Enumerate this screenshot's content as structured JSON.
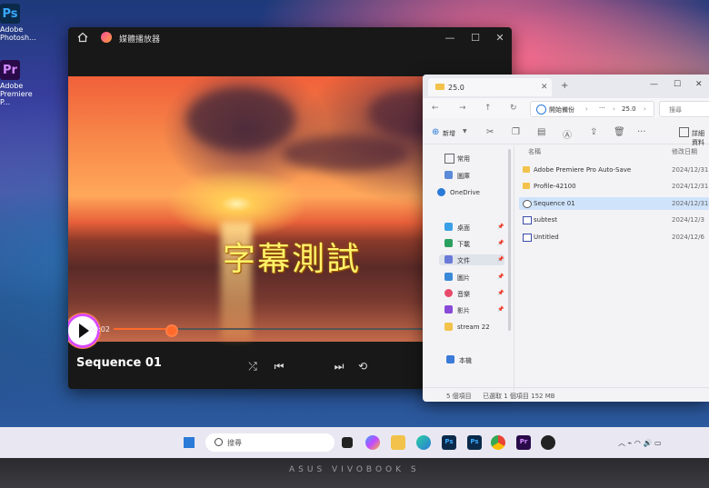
{
  "desktop": {
    "icons": [
      {
        "glyph": "Ps",
        "label": "Adobe Photosh..."
      },
      {
        "glyph": "Pr",
        "label": "Adobe Premiere P..."
      }
    ]
  },
  "player": {
    "title": "媒體播放器",
    "subtitle_text": "字幕測試",
    "current_time": "00:00:02",
    "progress_fraction": 0.15,
    "media_title": "Sequence 01",
    "accent_color": "#ff6a2a",
    "icons": [
      "home-icon",
      "shuffle-icon",
      "previous-icon",
      "play-icon",
      "next-icon",
      "repeat-off-icon"
    ]
  },
  "explorer": {
    "tab_title": "25.0",
    "address": {
      "start": "開始備份",
      "more": "···",
      "folder": "25.0"
    },
    "search_placeholder": "搜尋",
    "toolbar": {
      "new_label": "新增",
      "details_label": "詳細資料"
    },
    "nav": {
      "home": "常用",
      "gallery": "圖庫",
      "onedrive": "OneDrive",
      "desktop": "桌面",
      "downloads": "下載",
      "documents": "文件",
      "pictures": "圖片",
      "music": "音樂",
      "videos": "影片",
      "stream": "stream 22",
      "thispc": "本機"
    },
    "columns": {
      "name": "名稱",
      "date": "修改日期"
    },
    "files": [
      {
        "name": "Adobe Premiere Pro Auto-Save",
        "date": "2024/12/31",
        "type": "folder"
      },
      {
        "name": "Profile-42100",
        "date": "2024/12/31",
        "type": "folder"
      },
      {
        "name": "Sequence 01",
        "date": "2024/12/31",
        "type": "sequence"
      },
      {
        "name": "subtest",
        "date": "2024/12/3",
        "type": "document"
      },
      {
        "name": "Untitled",
        "date": "2024/12/6",
        "type": "document"
      }
    ],
    "status": {
      "count": "5 個項目",
      "selected": "已選取 1 個項目 152 MB"
    }
  },
  "taskbar": {
    "search_placeholder": "搜尋",
    "apps": {
      "ps": "Ps",
      "ps2": "Ps",
      "pr": "Pr"
    }
  },
  "bezel": {
    "brand": "ASUS VIVOBOOK S"
  }
}
